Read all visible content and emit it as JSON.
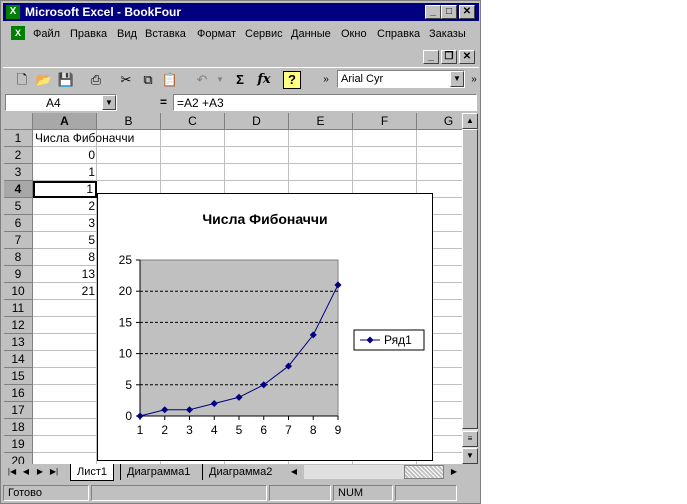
{
  "window": {
    "title": "Microsoft Excel - BookFour",
    "app_icon": "excel-icon"
  },
  "menu": [
    "Файл",
    "Правка",
    "Вид",
    "Вставка",
    "Формат",
    "Сервис",
    "Данные",
    "Окно",
    "Справка",
    "Заказы"
  ],
  "toolbar": {
    "font_name": "Arial Cyr",
    "sum_label": "Σ",
    "function_label": "fx",
    "help_label": "?"
  },
  "formula_bar": {
    "name_box": "A4",
    "equals": "=",
    "formula": "=A2 +A3"
  },
  "columns": [
    "A",
    "B",
    "C",
    "D",
    "E",
    "F",
    "G"
  ],
  "rows": [
    "1",
    "2",
    "3",
    "4",
    "5",
    "6",
    "7",
    "8",
    "9",
    "10",
    "11",
    "12",
    "13",
    "14",
    "15",
    "16",
    "17",
    "18",
    "19",
    "20"
  ],
  "cells": {
    "A1": "Числа Фибоначчи",
    "A2": "0",
    "A3": "1",
    "A4": "1",
    "A5": "2",
    "A6": "3",
    "A7": "5",
    "A8": "8",
    "A9": "13",
    "A10": "21"
  },
  "selected_cell": "A4",
  "sheet_tabs": [
    "Лист1",
    "Диаграмма1",
    "Диаграмма2"
  ],
  "status": {
    "ready": "Готово",
    "num": "NUM"
  },
  "chart_data": {
    "type": "line",
    "title": "Числа Фибоначчи",
    "categories": [
      "1",
      "2",
      "3",
      "4",
      "5",
      "6",
      "7",
      "8",
      "9"
    ],
    "series": [
      {
        "name": "Ряд1",
        "values": [
          0,
          1,
          1,
          2,
          3,
          5,
          8,
          13,
          21
        ]
      }
    ],
    "y_ticks": [
      "0",
      "5",
      "10",
      "15",
      "20",
      "25"
    ],
    "ylim": [
      0,
      25
    ],
    "grid": "horizontal dashed",
    "legend": "right",
    "plot_background": "#c0c0c0",
    "series_color": "#000080"
  }
}
